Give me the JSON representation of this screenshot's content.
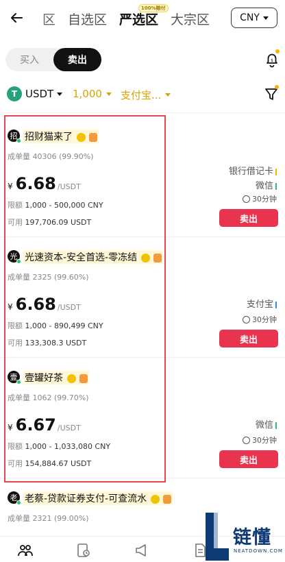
{
  "header": {
    "tabs": [
      {
        "label": "区",
        "state": "partial"
      },
      {
        "label": "自选区",
        "state": "normal"
      },
      {
        "label": "严选区",
        "state": "active",
        "badge": "100%赔付"
      },
      {
        "label": "大宗区",
        "state": "normal"
      }
    ],
    "currency": "CNY"
  },
  "toggle": {
    "buy": "买入",
    "sell": "卖出"
  },
  "filters": {
    "coin": "USDT",
    "amount": "1,000",
    "payment": "支付宝..."
  },
  "listings": [
    {
      "avatar": "招",
      "name": "招财猫来了",
      "orders_label": "成单量",
      "orders": "40306 (99.90%)",
      "currency_symbol": "¥",
      "price": "6.68",
      "unit": "/USDT",
      "limit_label": "限额",
      "limit": "1,000 - 500,000 CNY",
      "avail_label": "可用",
      "available": "197,706.09 USDT",
      "methods": [
        {
          "label": "银行借记卡",
          "color": "#f5b400"
        },
        {
          "label": "微信",
          "color": "#29c16b"
        }
      ],
      "time": "30分钟",
      "action": "卖出"
    },
    {
      "avatar": "光",
      "name": "光速资本-安全首选-零冻结",
      "orders_label": "成单量",
      "orders": "2325 (99.60%)",
      "currency_symbol": "¥",
      "price": "6.68",
      "unit": "/USDT",
      "limit_label": "限额",
      "limit": "1,000 - 890,499 CNY",
      "avail_label": "可用",
      "available": "133,308.3 USDT",
      "methods": [
        {
          "label": "支付宝",
          "color": "#2f8cf0"
        }
      ],
      "time": "30分钟",
      "action": "卖出"
    },
    {
      "avatar": "壹",
      "name": "壹罐好茶",
      "orders_label": "成单量",
      "orders": "1062 (99.70%)",
      "currency_symbol": "¥",
      "price": "6.67",
      "unit": "/USDT",
      "limit_label": "限额",
      "limit": "1,000 - 1,033,080 CNY",
      "avail_label": "可用",
      "available": "154,884.67 USDT",
      "methods": [
        {
          "label": "微信",
          "color": "#29c16b"
        }
      ],
      "time": "30分钟",
      "action": "卖出"
    },
    {
      "avatar": "老",
      "name": "老蔡-贷款证券支付-可查流水",
      "orders_label": "成单量",
      "orders": "2321 (99.00%)"
    }
  ],
  "watermark": {
    "text": "链懂",
    "sub": "NEATDOWN.COM"
  },
  "colors": {
    "accent": "#d9a400",
    "sell": "#e8344e",
    "highlight": "#e8434f"
  }
}
